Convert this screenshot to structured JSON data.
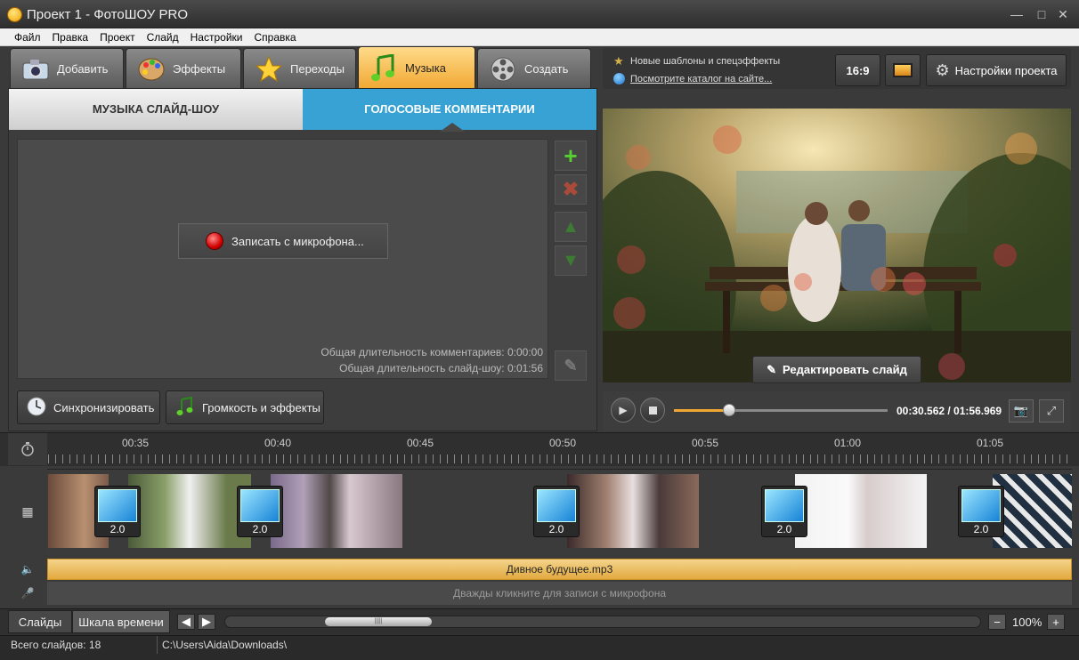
{
  "window": {
    "title": "Проект 1 - ФотоШОУ PRO"
  },
  "menu": [
    "Файл",
    "Правка",
    "Проект",
    "Слайд",
    "Настройки",
    "Справка"
  ],
  "tabs": [
    {
      "label": "Добавить",
      "icon": "camera-icon"
    },
    {
      "label": "Эффекты",
      "icon": "palette-icon"
    },
    {
      "label": "Переходы",
      "icon": "star-icon"
    },
    {
      "label": "Музыка",
      "icon": "music-note-icon",
      "active": true
    },
    {
      "label": "Создать",
      "icon": "film-reel-icon"
    }
  ],
  "subtabs": {
    "music": "МУЗЫКА СЛАЙД-ШОУ",
    "voice": "ГОЛОСОВЫЕ КОММЕНТАРИИ"
  },
  "record": {
    "button": "Записать с микрофона..."
  },
  "info": {
    "comments_total": "Общая длительность комментариев: 0:00:00",
    "slideshow_total": "Общая длительность слайд-шоу: 0:01:56"
  },
  "bottom_buttons": {
    "sync": "Синхронизировать",
    "volume": "Громкость и эффекты"
  },
  "right_header": {
    "new_templates": "Новые шаблоны и спецэффекты",
    "catalog_link": "Посмотрите каталог на сайте...",
    "aspect": "16:9",
    "project_settings": "Настройки проекта"
  },
  "preview": {
    "edit_slide": "Редактировать слайд",
    "time": "00:30.562 / 01:56.969",
    "progress": 0.26
  },
  "timeline": {
    "ticks": [
      "00:35",
      "00:40",
      "00:45",
      "00:50",
      "00:55",
      "01:00",
      "01:05"
    ],
    "transitions": [
      "2.0",
      "2.0",
      "2.0",
      "2.0",
      "2.0"
    ],
    "music_track": "Дивное будущее.mp3",
    "voice_hint": "Дважды кликните для записи с микрофона"
  },
  "bottom": {
    "slides_tab": "Слайды",
    "timeline_tab": "Шкала времени",
    "zoom": "100%"
  },
  "status": {
    "total_slides": "Всего слайдов: 18",
    "path": "C:\\Users\\Aida\\Downloads\\"
  },
  "colors": {
    "accent_orange": "#f1a832",
    "accent_blue": "#37a2d3"
  }
}
